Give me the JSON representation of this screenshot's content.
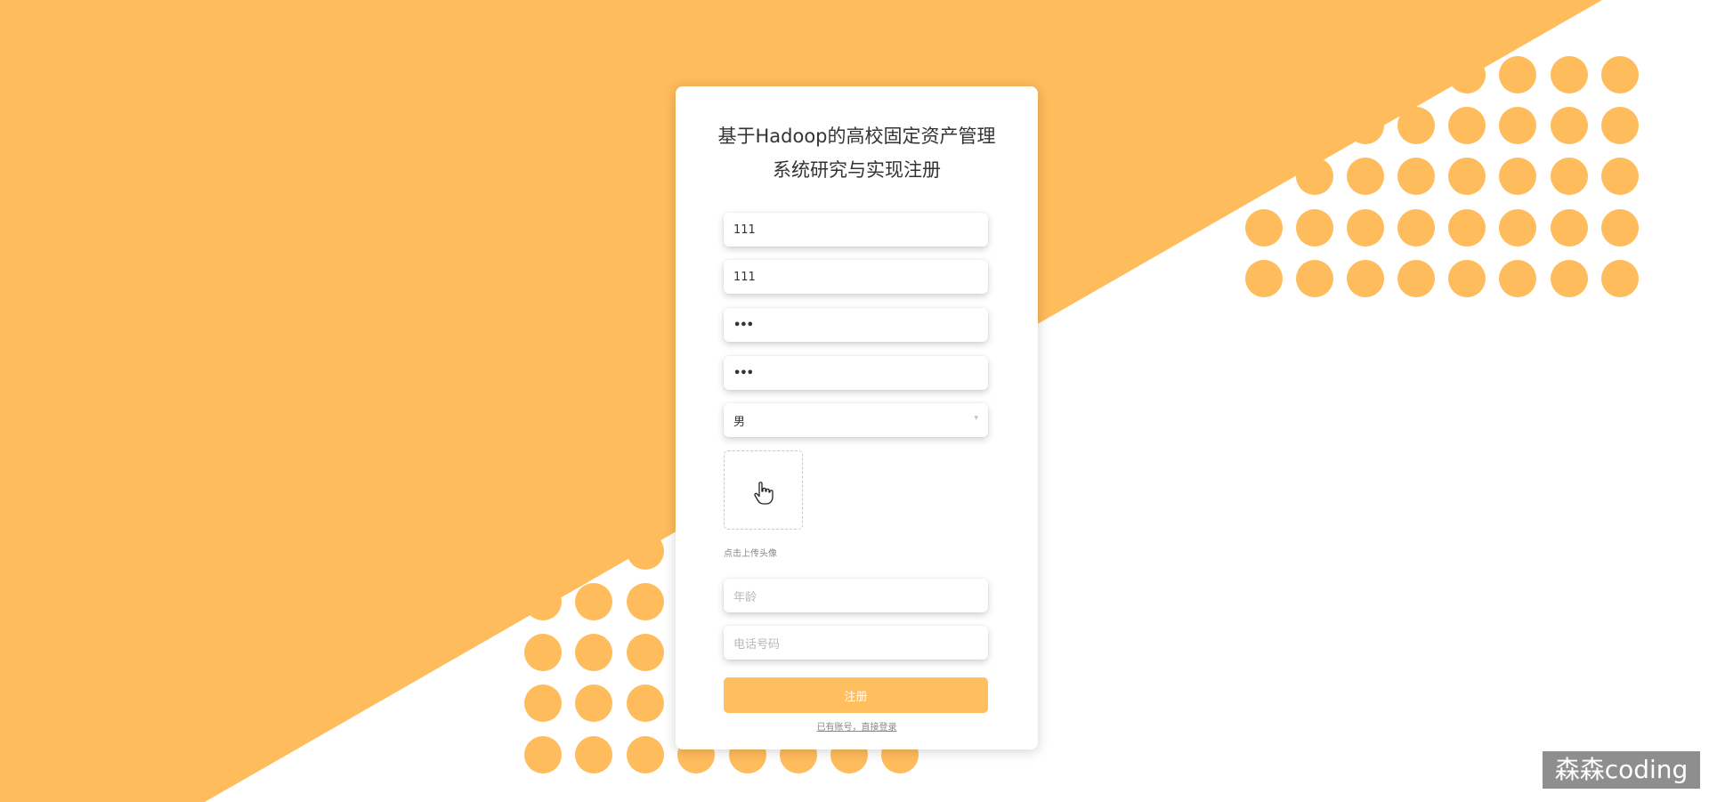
{
  "title": {
    "line1": "基于Hadoop的高校固定资产管理",
    "line2": "系统研究与实现注册"
  },
  "form": {
    "account_value": "111",
    "name_value": "111",
    "password_value": "•••",
    "confirm_password_value": "•••",
    "gender_value": "男",
    "avatar_hint": "点击上传头像",
    "age_placeholder": "年龄",
    "phone_placeholder": "电话号码",
    "register_label": "注册",
    "login_link": "已有账号，直接登录"
  },
  "watermark": "森森coding",
  "colors": {
    "accent": "#ffbf5e",
    "dots": "#ffbc5c"
  }
}
